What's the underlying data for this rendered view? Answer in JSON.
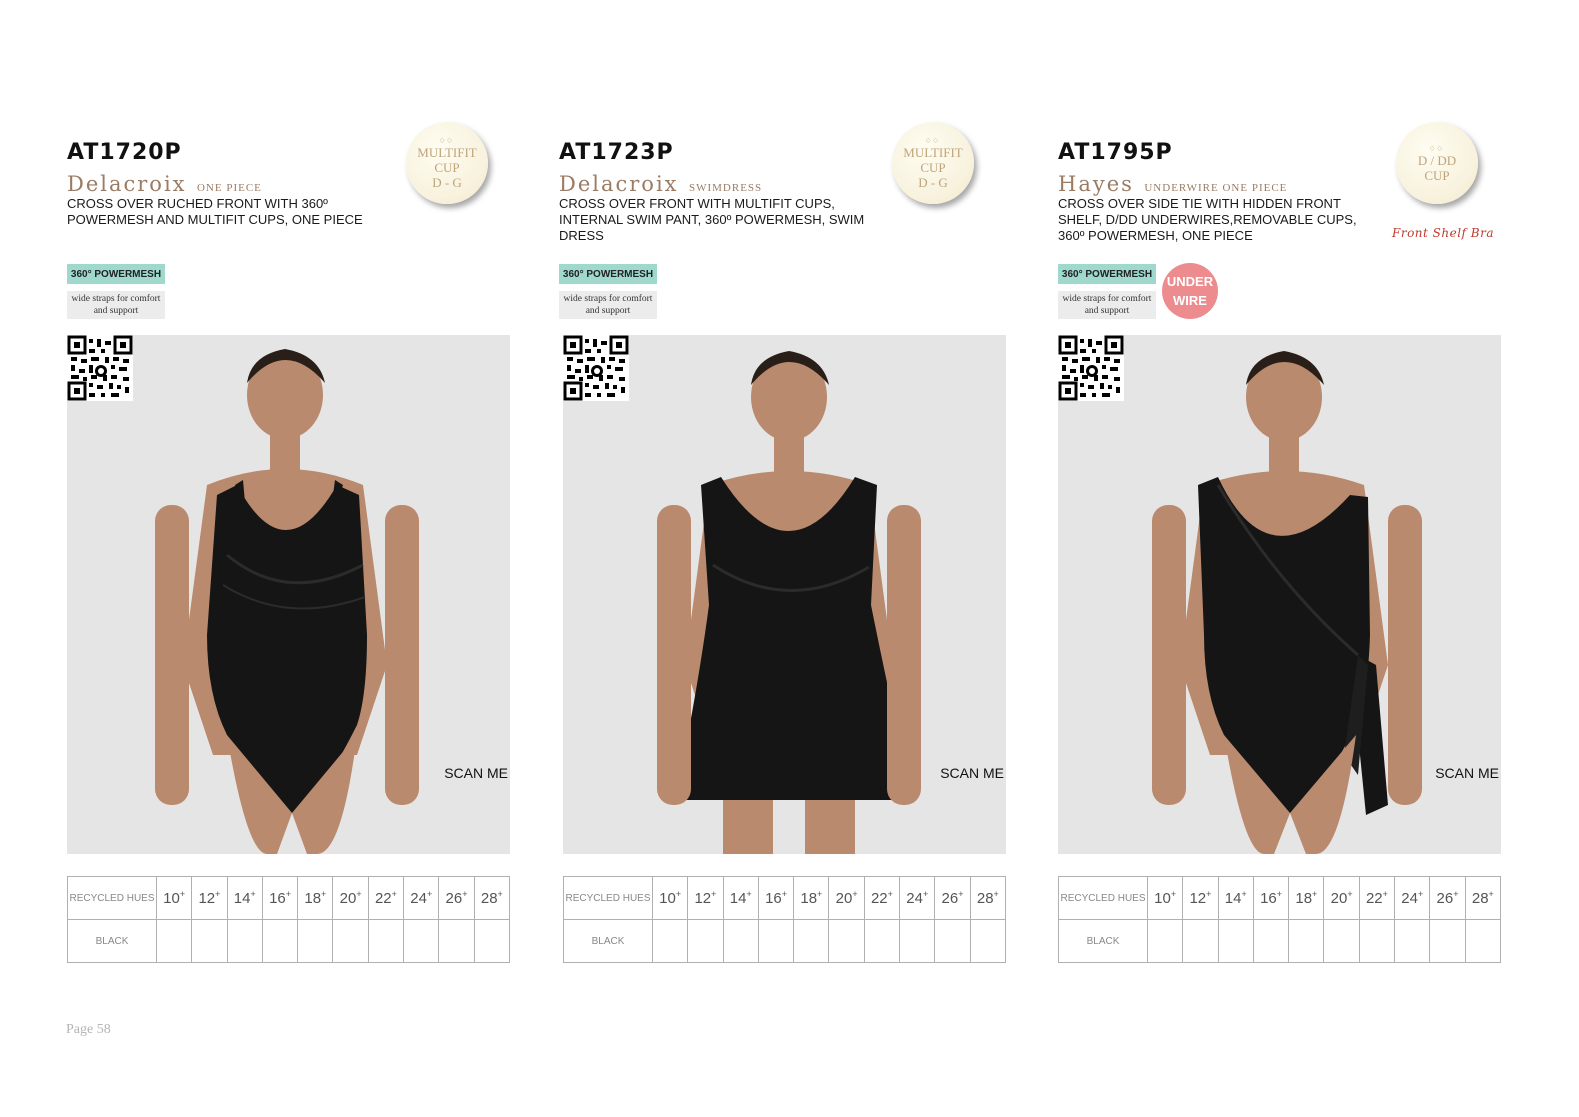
{
  "page_label": "Page 58",
  "colors": {
    "accent_name": "#9a7b64",
    "powermesh_tag": "#9fd8cc",
    "underwire_badge": "#ec8c8f",
    "photo_bg": "#e5e5e5"
  },
  "products": [
    {
      "code": "AT1720P",
      "name": "Delacroix",
      "subtype": "ONE PIECE",
      "description": "CROSS OVER RUCHED FRONT WITH 360º POWERMESH AND MULTIFIT CUPS, ONE PIECE",
      "cup_badge": [
        "MULTIFIT",
        "CUP",
        "D - G"
      ],
      "tags": {
        "powermesh": "360° POWERMESH",
        "straps": "wide straps for comfort and support"
      },
      "underwire": null,
      "extra_note": null,
      "silhouette": "one-piece",
      "scan_label": "SCAN ME",
      "table": {
        "hues_header": "RECYCLED HUES",
        "sizes": [
          "10",
          "12",
          "14",
          "16",
          "18",
          "20",
          "22",
          "24",
          "26",
          "28"
        ],
        "size_suffix": "+",
        "colors": [
          "BLACK"
        ]
      }
    },
    {
      "code": "AT1723P",
      "name": "Delacroix",
      "subtype": "SWIMDRESS",
      "description": "CROSS OVER FRONT WITH MULTIFIT CUPS, INTERNAL SWIM PANT, 360º POWERMESH, SWIM DRESS",
      "cup_badge": [
        "MULTIFIT",
        "CUP",
        "D - G"
      ],
      "tags": {
        "powermesh": "360° POWERMESH",
        "straps": "wide straps for comfort and support"
      },
      "underwire": null,
      "extra_note": null,
      "silhouette": "swimdress",
      "scan_label": "SCAN ME",
      "table": {
        "hues_header": "RECYCLED HUES",
        "sizes": [
          "10",
          "12",
          "14",
          "16",
          "18",
          "20",
          "22",
          "24",
          "26",
          "28"
        ],
        "size_suffix": "+",
        "colors": [
          "BLACK"
        ]
      }
    },
    {
      "code": "AT1795P",
      "name": "Hayes",
      "subtype": "UNDERWIRE ONE PIECE",
      "description": "CROSS OVER SIDE TIE WITH HIDDEN FRONT SHELF, D/DD UNDERWIRES,REMOVABLE CUPS, 360º POWERMESH, ONE PIECE",
      "cup_badge": [
        "D / DD",
        "CUP"
      ],
      "tags": {
        "powermesh": "360° POWERMESH",
        "straps": "wide straps for comfort and support"
      },
      "underwire": [
        "UNDER",
        "WIRE"
      ],
      "extra_note": "Front Shelf Bra",
      "silhouette": "side-tie",
      "scan_label": "SCAN ME",
      "table": {
        "hues_header": "RECYCLED HUES",
        "sizes": [
          "10",
          "12",
          "14",
          "16",
          "18",
          "20",
          "22",
          "24",
          "26",
          "28"
        ],
        "size_suffix": "+",
        "colors": [
          "BLACK"
        ]
      }
    }
  ]
}
